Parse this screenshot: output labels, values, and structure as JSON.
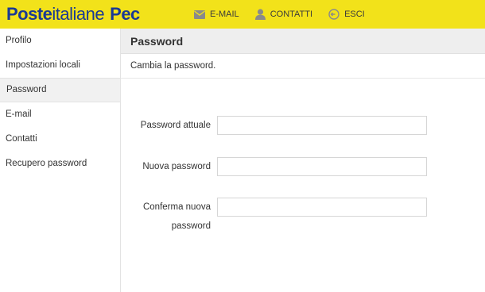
{
  "brand": {
    "logo_poste": "Poste",
    "logo_italiane": "italiane",
    "logo_pec": "Pec"
  },
  "topnav": {
    "items": [
      {
        "label": "E-MAIL",
        "icon": "envelope-icon"
      },
      {
        "label": "CONTATTI",
        "icon": "person-icon"
      },
      {
        "label": "ESCI",
        "icon": "logout-icon"
      }
    ]
  },
  "sidebar": {
    "items": [
      {
        "label": "Profilo"
      },
      {
        "label": "Impostazioni locali"
      },
      {
        "label": "Password",
        "active": true
      },
      {
        "label": "E-mail"
      },
      {
        "label": "Contatti"
      },
      {
        "label": "Recupero password"
      }
    ]
  },
  "main": {
    "title": "Password",
    "description": "Cambia la password.",
    "fields": [
      {
        "label": "Password attuale",
        "value": ""
      },
      {
        "label": "Nuova password",
        "value": ""
      },
      {
        "label_line1": "Conferma nuova",
        "label_line2": "password",
        "value": ""
      }
    ]
  },
  "colors": {
    "topbar": "#f2e21a",
    "brand_blue": "#1a3a94",
    "active_bg": "#f1f1f1",
    "header_bg": "#eeeeee"
  }
}
